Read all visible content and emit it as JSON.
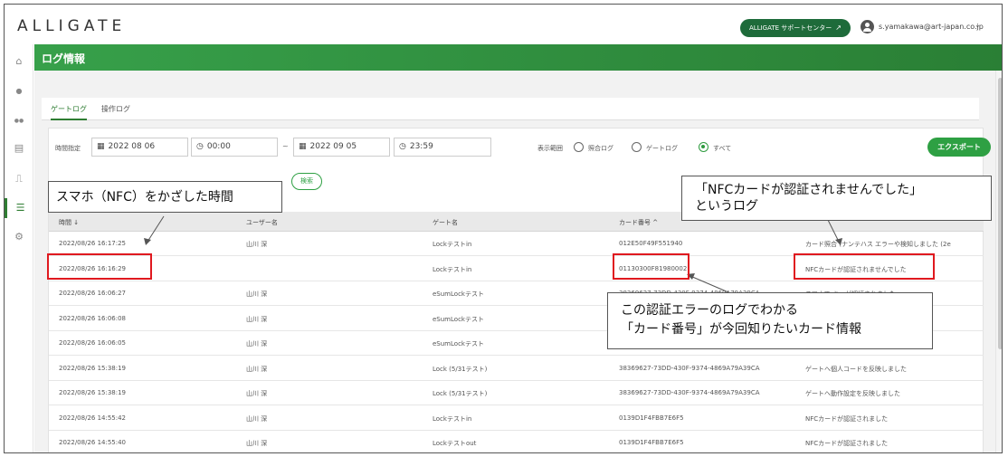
{
  "app": {
    "logo": "ALLIGATE",
    "support_label": "ALLIGATE サポートセンター",
    "user_email": "s.yamakawa@art-japan.co.jp"
  },
  "sidebar": {
    "items": [
      {
        "icon": "home-icon",
        "glyph": "⌂"
      },
      {
        "icon": "user-icon",
        "glyph": "●"
      },
      {
        "icon": "users-icon",
        "glyph": "●●"
      },
      {
        "icon": "id-card-icon",
        "glyph": "▤"
      },
      {
        "icon": "door-icon",
        "glyph": "⎍"
      },
      {
        "icon": "list-icon",
        "glyph": "☰"
      },
      {
        "icon": "gear-icon",
        "glyph": "⚙"
      }
    ]
  },
  "page": {
    "title": "ログ情報"
  },
  "tabs": [
    {
      "label": "ゲートログ"
    },
    {
      "label": "操作ログ"
    }
  ],
  "filters": {
    "period_label": "時間指定",
    "start_date": "2022 08 06",
    "start_time": "00:00",
    "end_date": "2022 09 05",
    "end_time": "23:59",
    "tilde": "~",
    "scope_label": "表示範囲",
    "scope_options": [
      "照合ログ",
      "ゲートログ",
      "すべて"
    ],
    "scope_selected": "すべて",
    "export_label": "エクスポート",
    "search_label": "検索"
  },
  "table": {
    "headers": [
      "時間 ↓",
      "ユーザー名",
      "ゲート名",
      "カード番号 ^",
      ""
    ],
    "rows": [
      [
        "2022/08/26 16:17:25",
        "山川 深",
        "Lockテストin",
        "012E50F49F551940",
        "カード照合 (ナンテハス エラーや検知しました (2e"
      ],
      [
        "2022/08/26 16:16:29",
        "",
        "Lockテストin",
        "01130300F81980002",
        "NFCカードが認証されませんでした"
      ],
      [
        "2022/08/26 16:06:27",
        "山川 深",
        "eSumLockテスト",
        "38369627-73DD-430F-9374-4869A79A39CA",
        "スマホで キーが認証されました"
      ],
      [
        "2022/08/26 16:06:08",
        "山川 深",
        "eSumLockテスト",
        "",
        ""
      ],
      [
        "2022/08/26 16:06:05",
        "山川 深",
        "eSumLockテスト",
        "",
        ""
      ],
      [
        "2022/08/26 15:38:19",
        "山川 深",
        "Lock (5/31テスト)",
        "38369627-73DD-430F-9374-4869A79A39CA",
        "ゲートへ個人コードを反映しました"
      ],
      [
        "2022/08/26 15:38:19",
        "山川 深",
        "Lock (5/31テスト)",
        "38369627-73DD-430F-9374-4869A79A39CA",
        "ゲートへ動作設定を反映しました"
      ],
      [
        "2022/08/26 14:55:42",
        "山川 深",
        "Lockテストin",
        "0139D1F4FBB7E6F5",
        "NFCカードが認証されました"
      ],
      [
        "2022/08/26 14:55:40",
        "山川 深",
        "Lockテストout",
        "0139D1F4FBB7E6F5",
        "NFCカードが認証されました"
      ]
    ]
  },
  "annotations": {
    "callout1": "スマホ（NFC）をかざした時間",
    "callout2_line1": "「NFCカードが認証されませんでした」",
    "callout2_line2": "というログ",
    "callout3_line1": "この認証エラーのログでわかる",
    "callout3_line2": "「カード番号」が今回知りたいカード情報",
    "highlight_color": "#e0191f"
  }
}
